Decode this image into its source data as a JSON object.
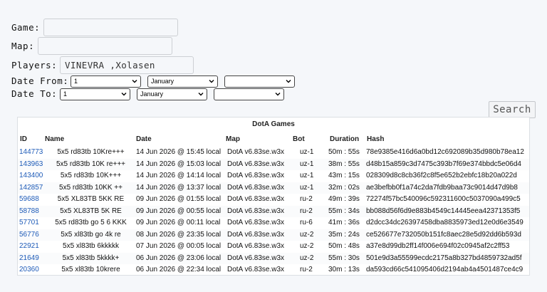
{
  "form": {
    "game_label": "Game:",
    "game_value": "",
    "map_label": "Map:",
    "map_value": "",
    "players_label": "Players:",
    "players_value": "VINEVRA ,Xolasen",
    "date_from_label": "Date From:",
    "date_from": {
      "day": "1",
      "month": "January",
      "year": ""
    },
    "date_to_label": "Date To:",
    "date_to": {
      "day": "1",
      "month": "January",
      "year": ""
    },
    "search_label": "Search"
  },
  "table": {
    "title": "DotA Games",
    "headers": {
      "id": "ID",
      "name": "Name",
      "date": "Date",
      "map": "Map",
      "bot": "Bot",
      "duration": "Duration",
      "hash": "Hash"
    },
    "rows": [
      {
        "id": "144773",
        "name": "5x5 rd83tb 10Kre+++",
        "date": "14 Jun 2026 @ 15:45 local",
        "map": "DotA v6.83se.w3x",
        "bot": "uz-1",
        "duration": "50m : 55s",
        "hash": "78e9385e416d6a0bd12c692089b35d980b78ea12"
      },
      {
        "id": "143963",
        "name": "5x5 rd83tb 10K re+++",
        "date": "14 Jun 2026 @ 15:03 local",
        "map": "DotA v6.83se.w3x",
        "bot": "uz-1",
        "duration": "38m : 55s",
        "hash": "d48b15a859c3d7475c393b7f69e374bbdc5e06d4"
      },
      {
        "id": "143400",
        "name": "5x5 rd83tb 10K+++",
        "date": "14 Jun 2026 @ 14:14 local",
        "map": "DotA v6.83se.w3x",
        "bot": "uz-1",
        "duration": "43m : 15s",
        "hash": "028309d8c8cb36f2c8f5e652b2ebfc18b20a022d"
      },
      {
        "id": "142857",
        "name": "5x5 rd83tb 10KK ++",
        "date": "14 Jun 2026 @ 13:37 local",
        "map": "DotA v6.83se.w3x",
        "bot": "uz-1",
        "duration": "32m : 02s",
        "hash": "ae3befbb0f1a74c2da7fdb9baa73c9014d47d9b8"
      },
      {
        "id": "59688",
        "name": "5x5 XL83TB 5KK RE",
        "date": "09 Jun 2026 @ 01:55 local",
        "map": "DotA v6.83se.w3x",
        "bot": "ru-2",
        "duration": "49m : 39s",
        "hash": "72274f57bc540096c592311600c5037090a499c5"
      },
      {
        "id": "58788",
        "name": "5x5 XL83TB 5K RE",
        "date": "09 Jun 2026 @ 00:55 local",
        "map": "DotA v6.83se.w3x",
        "bot": "ru-2",
        "duration": "55m : 34s",
        "hash": "bb088d56f6d9e883b4549c14445eea42371353f5"
      },
      {
        "id": "57701",
        "name": "5x5 rd83tb go 5 6 KKK",
        "date": "09 Jun 2026 @ 00:11 local",
        "map": "DotA v6.83se.w3x",
        "bot": "ru-6",
        "duration": "41m : 36s",
        "hash": "d2dcc34dc26397458dba8835973ed12e0d6e3549"
      },
      {
        "id": "56776",
        "name": "5x5 xl83tb go 4k re",
        "date": "08 Jun 2026 @ 23:35 local",
        "map": "DotA v6.83se.w3x",
        "bot": "uz-2",
        "duration": "35m : 24s",
        "hash": "ce526677e732050b151fc8aec28e5d92dd6b593d"
      },
      {
        "id": "22921",
        "name": "5x5 xl83tb 6kkkkk",
        "date": "07 Jun 2026 @ 00:05 local",
        "map": "DotA v6.83se.w3x",
        "bot": "uz-2",
        "duration": "50m : 48s",
        "hash": "a37e8d99db2ff14f006e694f02c0945af2c2ff53"
      },
      {
        "id": "21649",
        "name": "5x5 xl83tb 5kkkk+",
        "date": "06 Jun 2026 @ 23:06 local",
        "map": "DotA v6.83se.w3x",
        "bot": "uz-2",
        "duration": "55m : 30s",
        "hash": "501e9d3a55599ecdc2175a8b327bd4859732ad5f"
      },
      {
        "id": "20360",
        "name": "5x5 xl83tb 10krere",
        "date": "06 Jun 2026 @ 22:34 local",
        "map": "DotA v6.83se.w3x",
        "bot": "ru-2",
        "duration": "30m : 13s",
        "hash": "da593cd66c541095406d2194ab4a4501487ce4c9"
      }
    ]
  },
  "icons": {
    "select_arrow": "chevron-down-icon"
  }
}
